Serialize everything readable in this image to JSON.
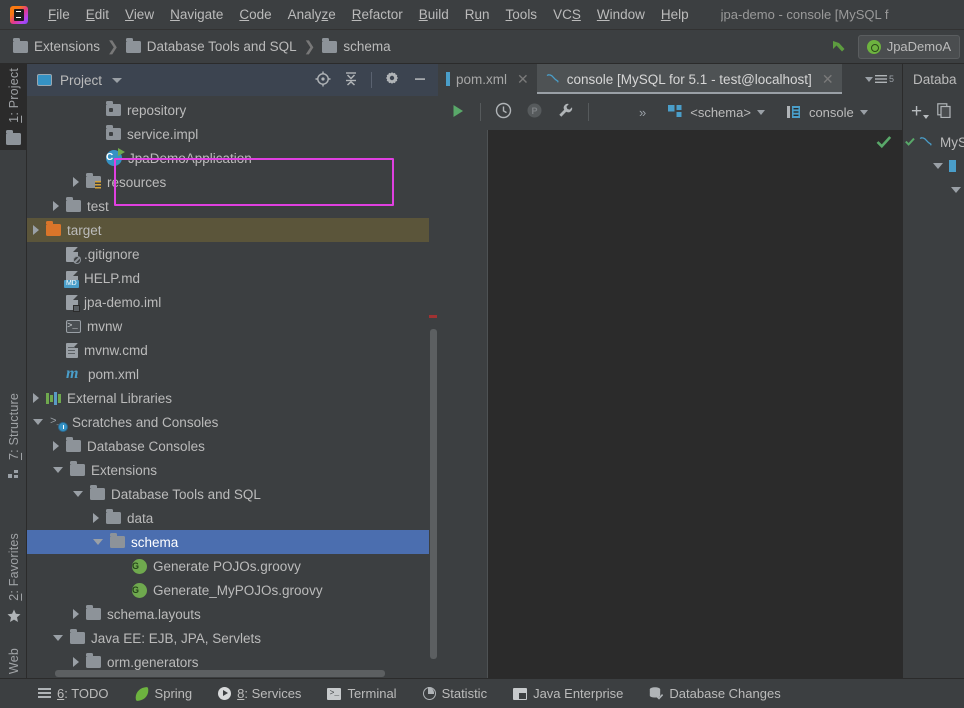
{
  "menubar": {
    "items": [
      {
        "label": "File",
        "mnemonic": "F"
      },
      {
        "label": "Edit",
        "mnemonic": "E"
      },
      {
        "label": "View",
        "mnemonic": "V"
      },
      {
        "label": "Navigate",
        "mnemonic": "N"
      },
      {
        "label": "Code",
        "mnemonic": "C"
      },
      {
        "label": "Analyze",
        "mnemonic": "z"
      },
      {
        "label": "Refactor",
        "mnemonic": "R"
      },
      {
        "label": "Build",
        "mnemonic": "B"
      },
      {
        "label": "Run",
        "mnemonic": "u"
      },
      {
        "label": "Tools",
        "mnemonic": "T"
      },
      {
        "label": "VCS",
        "mnemonic": "S"
      },
      {
        "label": "Window",
        "mnemonic": "W"
      },
      {
        "label": "Help",
        "mnemonic": "H"
      }
    ],
    "window_title": "jpa-demo - console [MySQL f"
  },
  "navbar": {
    "breadcrumbs": [
      "Extensions",
      "Database Tools and SQL",
      "schema"
    ],
    "separator": "❯",
    "run_configuration": "JpaDemoA"
  },
  "left_strip": {
    "tabs": [
      {
        "label": "1: Project",
        "mnemonic": "1",
        "icon": "folder-icon",
        "active": true
      },
      {
        "label": "7: Structure",
        "mnemonic": "7",
        "icon": "structure-icon",
        "active": false
      },
      {
        "label": "2: Favorites",
        "mnemonic": "2",
        "icon": "star-icon",
        "active": false
      },
      {
        "label": "Web",
        "mnemonic": "",
        "icon": "globe-icon",
        "active": false
      }
    ]
  },
  "project_panel": {
    "title": "Project",
    "tools": [
      "locate-icon",
      "collapse-all-icon",
      "settings-icon",
      "minimize-icon"
    ],
    "tree": [
      {
        "label": "repository",
        "indent": 66,
        "twisty": "none",
        "icon": "package",
        "state": "normal"
      },
      {
        "label": "service.impl",
        "indent": 66,
        "twisty": "none",
        "icon": "package",
        "state": "normal"
      },
      {
        "label": "JpaDemoApplication",
        "indent": 66,
        "twisty": "none",
        "icon": "springapp",
        "state": "normal"
      },
      {
        "label": "resources",
        "indent": 46,
        "twisty": "closed",
        "icon": "resources",
        "state": "normal"
      },
      {
        "label": "test",
        "indent": 26,
        "twisty": "closed",
        "icon": "folder",
        "state": "normal"
      },
      {
        "label": "target",
        "indent": 6,
        "twisty": "closed",
        "icon": "folder-orange",
        "state": "excluded"
      },
      {
        "label": ".gitignore",
        "indent": 26,
        "twisty": "none",
        "icon": "gitignore",
        "state": "normal"
      },
      {
        "label": "HELP.md",
        "indent": 26,
        "twisty": "none",
        "icon": "markdown",
        "state": "normal"
      },
      {
        "label": "jpa-demo.iml",
        "indent": 26,
        "twisty": "none",
        "icon": "iml",
        "state": "normal"
      },
      {
        "label": "mvnw",
        "indent": 26,
        "twisty": "none",
        "icon": "shell",
        "state": "normal"
      },
      {
        "label": "mvnw.cmd",
        "indent": 26,
        "twisty": "none",
        "icon": "textfile",
        "state": "normal"
      },
      {
        "label": "pom.xml",
        "indent": 26,
        "twisty": "none",
        "icon": "maven",
        "state": "normal"
      },
      {
        "label": "External Libraries",
        "indent": 6,
        "twisty": "closed",
        "icon": "libraries",
        "state": "normal"
      },
      {
        "label": "Scratches and Consoles",
        "indent": 6,
        "twisty": "open",
        "icon": "scratches",
        "state": "normal"
      },
      {
        "label": "Database Consoles",
        "indent": 26,
        "twisty": "closed",
        "icon": "folder",
        "state": "normal"
      },
      {
        "label": "Extensions",
        "indent": 26,
        "twisty": "open",
        "icon": "folder",
        "state": "normal"
      },
      {
        "label": "Database Tools and SQL",
        "indent": 46,
        "twisty": "open",
        "icon": "folder",
        "state": "normal"
      },
      {
        "label": "data",
        "indent": 66,
        "twisty": "closed",
        "icon": "folder",
        "state": "normal"
      },
      {
        "label": "schema",
        "indent": 66,
        "twisty": "open",
        "icon": "folder",
        "state": "selected"
      },
      {
        "label": "Generate POJOs.groovy",
        "indent": 92,
        "twisty": "none",
        "icon": "groovy",
        "state": "normal"
      },
      {
        "label": "Generate_MyPOJOs.groovy",
        "indent": 92,
        "twisty": "none",
        "icon": "groovy",
        "state": "normal"
      },
      {
        "label": "schema.layouts",
        "indent": 46,
        "twisty": "closed",
        "icon": "folder",
        "state": "normal"
      },
      {
        "label": "Java EE: EJB, JPA, Servlets",
        "indent": 26,
        "twisty": "open",
        "icon": "folder",
        "state": "normal"
      },
      {
        "label": "orm.generators",
        "indent": 46,
        "twisty": "closed",
        "icon": "folder",
        "state": "normal"
      }
    ]
  },
  "editor": {
    "tabs": [
      {
        "label": "pom.xml",
        "icon": "xml-icon",
        "active": false,
        "closable": true
      },
      {
        "label": "console [MySQL for 5.1 - test@localhost]",
        "icon": "mysql-icon",
        "active": true,
        "closable": true
      }
    ],
    "tab_overflow_count": "5",
    "toolbar": {
      "run": "run-icon",
      "history": "history-icon",
      "disabled_button": "P",
      "wrench": "wrench-icon",
      "overflow": "»",
      "schema_selector": "<schema>",
      "session_selector": "console"
    },
    "content": ""
  },
  "database_panel": {
    "title": "Databa",
    "tools": [
      "add-icon",
      "copy-icon"
    ],
    "tree": [
      {
        "label": "MyS",
        "icon": "mysql-icon",
        "indent": 8,
        "twisty": "none"
      },
      {
        "label": "",
        "icon": "schema-icon",
        "indent": 22,
        "twisty": "open"
      },
      {
        "label": "",
        "icon": "table-icon",
        "indent": 36,
        "twisty": "open"
      }
    ]
  },
  "statusbar": {
    "items": [
      {
        "label": "6: TODO",
        "mnemonic": "6",
        "icon": "todo-icon"
      },
      {
        "label": "Spring",
        "mnemonic": "",
        "icon": "spring-leaf-icon"
      },
      {
        "label": "8: Services",
        "mnemonic": "8",
        "icon": "services-play-icon"
      },
      {
        "label": "Terminal",
        "mnemonic": "",
        "icon": "terminal-icon"
      },
      {
        "label": "Statistic",
        "mnemonic": "",
        "icon": "statistic-pie-icon"
      },
      {
        "label": "Java Enterprise",
        "mnemonic": "",
        "icon": "java-enterprise-icon"
      },
      {
        "label": "Database Changes",
        "mnemonic": "",
        "icon": "database-changes-icon"
      }
    ]
  },
  "colors": {
    "background": "#3c3f41",
    "editor_background": "#2b2b2b",
    "selection": "#4b6eaf",
    "excluded_row": "#5b553a",
    "panel_header": "#3c4450",
    "annotation_box": "#e040e0",
    "accent_green": "#6fa94e",
    "accent_blue": "#3592c4",
    "text": "#bbbbbb"
  }
}
